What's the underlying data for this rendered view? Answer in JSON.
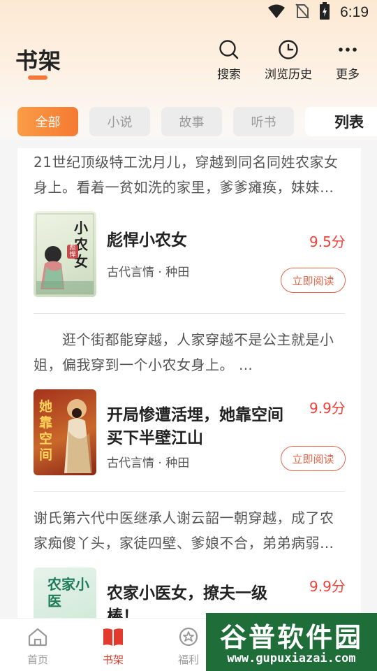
{
  "status_bar": {
    "time": "6:19",
    "icons": [
      "wifi-icon",
      "no-sim-icon",
      "battery-charging-icon"
    ]
  },
  "header": {
    "title": "书架",
    "actions": [
      {
        "label": "搜索",
        "icon": "search-icon"
      },
      {
        "label": "浏览历史",
        "icon": "clock-icon"
      },
      {
        "label": "更多",
        "icon": "more-dots-icon"
      }
    ]
  },
  "tabs": {
    "items": [
      "全部",
      "小说",
      "故事",
      "听书"
    ],
    "active": "全部",
    "list_toggle": "列表"
  },
  "books": [
    {
      "synopsis": [
        "21世纪顶级特工沈月儿，穿越到同名同姓农家女",
        "身上。看着一贫如洗的家里，爹爹瘫痪，妹妹…"
      ],
      "title": "彪悍小农女",
      "score": "9.5分",
      "tags": "古代言情 · 种田",
      "button": "立即阅读",
      "cover_text": "小农女",
      "cover_badge": "彪悍"
    },
    {
      "synopsis": [
        "　　逛个街都能穿越，人家穿越不是公主就是小",
        "姐，偏我穿到一个小农女身上。 …"
      ],
      "title_lines": [
        "开局惨遭活埋，她靠空间",
        "买下半壁江山"
      ],
      "score": "9.9分",
      "tags": "古代言情 · 种田",
      "button": "立即阅读",
      "cover_text": "她靠空间"
    },
    {
      "synopsis": [
        "谢氏第六代中医继承人谢云韶一朝穿越，成了农",
        "家痴傻丫头，家徒四壁、爹娘不合，弟弟病弱…"
      ],
      "title_lines": [
        "农家小医女，撩夫一级",
        "棒！"
      ],
      "score": "9.9分",
      "cover_text": "农家小医"
    }
  ],
  "bottom_nav": [
    {
      "label": "首页",
      "icon": "home-icon"
    },
    {
      "label": "书架",
      "icon": "book-icon",
      "active": true
    },
    {
      "label": "福利",
      "icon": "gift-icon"
    }
  ],
  "watermark": {
    "logo": "谷普软件园",
    "url": "www.gupuxiazai.com"
  },
  "colors": {
    "accent": "#f47a32",
    "score": "#f0413a",
    "button": "#e2674a",
    "nav_active": "#e23a2c"
  }
}
